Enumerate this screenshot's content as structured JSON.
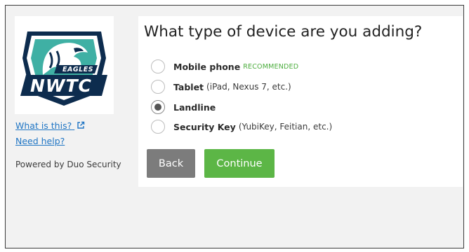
{
  "sidebar": {
    "logo": {
      "wordmark": "NWTC",
      "team": "EAGLES",
      "colors": {
        "navy": "#0d2c4e",
        "teal": "#3fb0a4"
      }
    },
    "links": [
      {
        "label": "What is this?",
        "icon": "external-link-icon"
      },
      {
        "label": "Need help?"
      }
    ],
    "powered_by": "Powered by Duo Security"
  },
  "main": {
    "heading": "What type of device are you adding?",
    "options": [
      {
        "label": "Mobile phone",
        "detail": "",
        "badge": "RECOMMENDED",
        "selected": false
      },
      {
        "label": "Tablet",
        "detail": "(iPad, Nexus 7, etc.)",
        "badge": "",
        "selected": false
      },
      {
        "label": "Landline",
        "detail": "",
        "badge": "",
        "selected": true
      },
      {
        "label": "Security Key",
        "detail": "(YubiKey, Feitian, etc.)",
        "badge": "",
        "selected": false
      }
    ],
    "buttons": {
      "back": "Back",
      "continue": "Continue"
    }
  },
  "colors": {
    "link": "#1f75c4",
    "accent_green": "#5cb646",
    "back_gray": "#7c7c7c",
    "background": "#f2f2f2"
  }
}
